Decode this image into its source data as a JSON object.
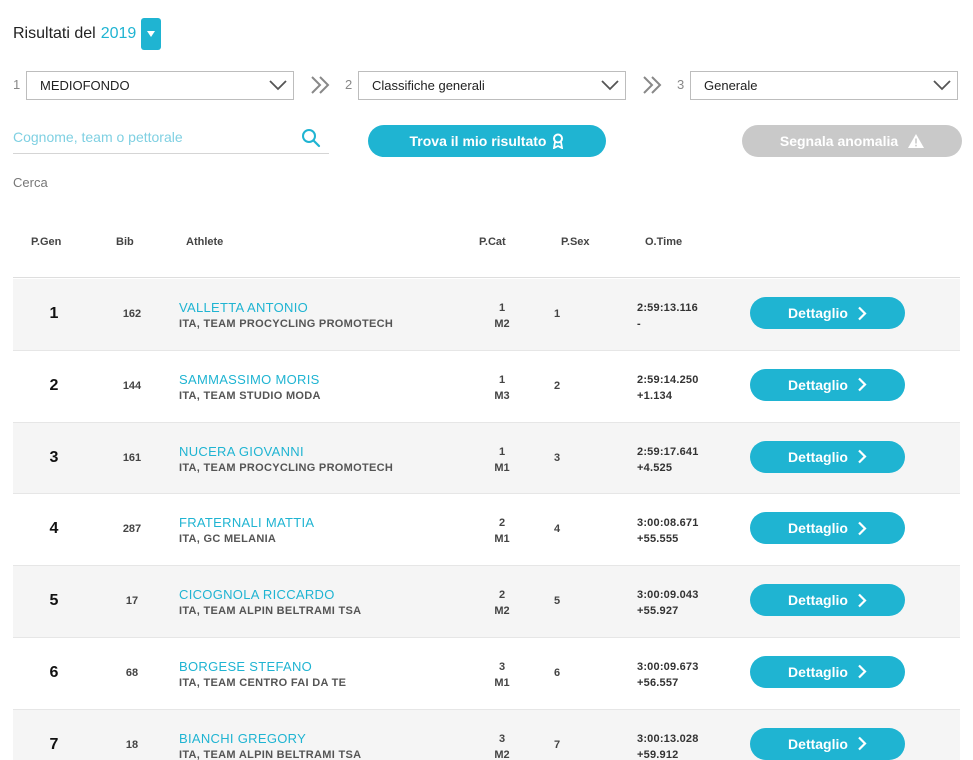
{
  "header": {
    "results_label": "Risultati del",
    "year": "2019",
    "year_toggle_icon": "caret-down-icon"
  },
  "filters": [
    {
      "step": "1",
      "value": "MEDIOFONDO"
    },
    {
      "step": "2",
      "value": "Classifiche generali"
    },
    {
      "step": "3",
      "value": "Generale"
    }
  ],
  "search": {
    "placeholder": "Cognome, team o pettorale",
    "value": "",
    "caption": "Cerca"
  },
  "buttons": {
    "find_label": "Trova il mio risultato",
    "anomaly_label": "Segnala anomalia"
  },
  "table": {
    "columns": {
      "p_gen": "P.Gen",
      "bib": "Bib",
      "athlete": "Athlete",
      "p_cat": "P.Cat",
      "p_sex": "P.Sex",
      "o_time": "O.Time"
    },
    "detail_label": "Dettaglio",
    "rows": [
      {
        "pos": "1",
        "bib": "162",
        "name": "VALLETTA ANTONIO",
        "team": "ITA, TEAM PROCYCLING PROMOTECH",
        "cat_pos": "1",
        "cat": "M2",
        "sex": "1",
        "time": "2:59:13.116",
        "gap": "-"
      },
      {
        "pos": "2",
        "bib": "144",
        "name": "SAMMASSIMO MORIS",
        "team": "ITA, TEAM STUDIO MODA",
        "cat_pos": "1",
        "cat": "M3",
        "sex": "2",
        "time": "2:59:14.250",
        "gap": "+1.134"
      },
      {
        "pos": "3",
        "bib": "161",
        "name": "NUCERA GIOVANNI",
        "team": "ITA, TEAM PROCYCLING PROMOTECH",
        "cat_pos": "1",
        "cat": "M1",
        "sex": "3",
        "time": "2:59:17.641",
        "gap": "+4.525"
      },
      {
        "pos": "4",
        "bib": "287",
        "name": "FRATERNALI MATTIA",
        "team": "ITA, GC MELANIA",
        "cat_pos": "2",
        "cat": "M1",
        "sex": "4",
        "time": "3:00:08.671",
        "gap": "+55.555"
      },
      {
        "pos": "5",
        "bib": "17",
        "name": "CICOGNOLA RICCARDO",
        "team": "ITA, TEAM ALPIN BELTRAMI TSA",
        "cat_pos": "2",
        "cat": "M2",
        "sex": "5",
        "time": "3:00:09.043",
        "gap": "+55.927"
      },
      {
        "pos": "6",
        "bib": "68",
        "name": "BORGESE STEFANO",
        "team": "ITA, TEAM CENTRO FAI DA TE",
        "cat_pos": "3",
        "cat": "M1",
        "sex": "6",
        "time": "3:00:09.673",
        "gap": "+56.557"
      },
      {
        "pos": "7",
        "bib": "18",
        "name": "BIANCHI GREGORY",
        "team": "ITA, TEAM ALPIN BELTRAMI TSA",
        "cat_pos": "3",
        "cat": "M2",
        "sex": "7",
        "time": "3:00:13.028",
        "gap": "+59.912"
      }
    ]
  },
  "colors": {
    "accent": "#1fb4d2",
    "disabled": "#c9c9c9",
    "row_alt": "#f5f5f5"
  }
}
